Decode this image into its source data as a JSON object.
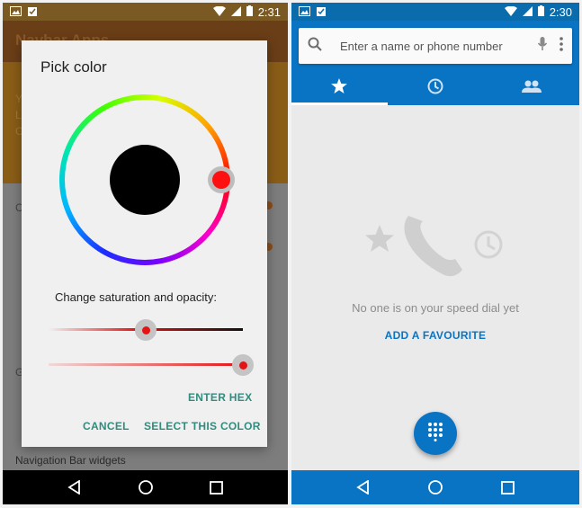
{
  "left_phone": {
    "status": {
      "time": "2:31"
    },
    "background_app": {
      "title": "Navbar Apps",
      "orange_lines": [
        "Y",
        "L",
        "C"
      ],
      "fragments": [
        "C",
        "G"
      ],
      "bottom_label": "Navigation Bar widgets"
    },
    "dialog": {
      "title": "Pick color",
      "selected_color": "#000000",
      "hue_handle_color": "#ff1010",
      "saturation_label": "Change saturation and opacity:",
      "saturation_value": 0.5,
      "opacity_value": 1.0,
      "enter_hex_label": "ENTER HEX",
      "cancel_label": "CANCEL",
      "select_label": "SELECT THIS COLOR"
    },
    "nav": {
      "back": "back-icon",
      "home": "home-icon",
      "recents": "recents-icon"
    }
  },
  "right_phone": {
    "status": {
      "time": "2:30"
    },
    "search": {
      "placeholder": "Enter a name or phone number"
    },
    "tabs": [
      {
        "icon": "star-icon",
        "active": true
      },
      {
        "icon": "clock-icon",
        "active": false
      },
      {
        "icon": "people-icon",
        "active": false
      }
    ],
    "empty_message": "No one is on your speed dial yet",
    "add_favourite_label": "ADD A FAVOURITE",
    "accent_color": "#0a74c4"
  }
}
